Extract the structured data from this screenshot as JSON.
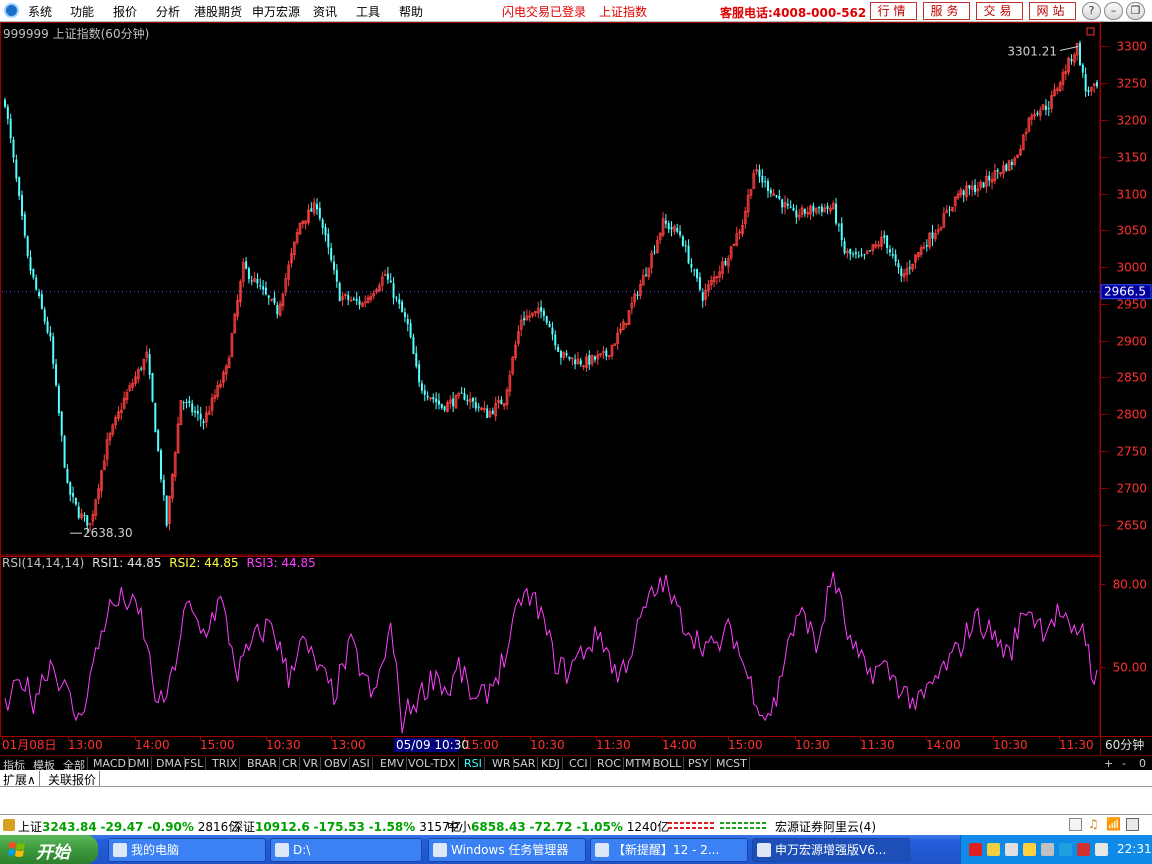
{
  "app": {
    "menu": [
      "系统",
      "功能",
      "报价",
      "分析",
      "港股期货",
      "申万宏源",
      "资讯",
      "工具",
      "帮助"
    ],
    "status_flash": "闪电交易已登录",
    "status_index": "上证指数",
    "hotline": "客服电话:4008-000-562",
    "quick_buttons": [
      "行情",
      "服务",
      "交易",
      "网站"
    ],
    "window_buttons": {
      "help": "?",
      "minimize": "–",
      "restore": "❐",
      "close": "✕"
    }
  },
  "chart_header": {
    "caption": "999999 上证指数(60分钟)",
    "rsi_name": "RSI(14,14,14)",
    "rsi1": "RSI1: 44.85",
    "rsi2": "RSI2: 44.85",
    "rsi3": "RSI3: 44.85",
    "period_label": "60分钟",
    "current_price": "2966.5"
  },
  "colors": {
    "up": "#ff4040",
    "down": "#54ffff",
    "rsi": "#ff40ff",
    "axis": "#a00000",
    "grid": "#8b0000",
    "price_tick": "#ff3030",
    "rsi2": "#ffff40"
  },
  "indicator_tabs": [
    "指标",
    "模板",
    "全部",
    "MACD",
    "DMI",
    "DMA",
    "FSL",
    "TRIX",
    "BRAR",
    "CR",
    "VR",
    "OBV",
    "ASI",
    "EMV",
    "VOL-TDX",
    "RSI",
    "WR",
    "SAR",
    "KDJ",
    "CCI",
    "ROC",
    "MTM",
    "BOLL",
    "PSY",
    "MCST"
  ],
  "indicator_controls": [
    "+",
    "-",
    "0"
  ],
  "extension_tabs": [
    "扩展∧",
    "关联报价"
  ],
  "index_bar": [
    {
      "name": "上证",
      "value": "3243.84",
      "change": "-29.47",
      "pct": "-0.90%",
      "amount": "2816亿"
    },
    {
      "name": "深证",
      "value": "10912.6",
      "change": "-175.53",
      "pct": "-1.58%",
      "amount": "3157亿"
    },
    {
      "name": "中小",
      "value": "6858.43",
      "change": "-72.72",
      "pct": "-1.05%",
      "amount": "1240亿"
    }
  ],
  "broker_label": "宏源证券阿里云(4)",
  "taskbar": {
    "start": "开始",
    "tasks": [
      "我的电脑",
      "D:\\",
      "Windows 任务管理器",
      "【新提醒】12 - 2...",
      "申万宏源增强版V6..."
    ],
    "clock": "22:31"
  },
  "chart_data": [
    {
      "type": "candlestick",
      "title": "999999 上证指数(60分钟)",
      "ylim": [
        2610,
        3325
      ],
      "yticks": [
        2650,
        2700,
        2750,
        2800,
        2850,
        2900,
        2950,
        3000,
        3050,
        3100,
        3150,
        3200,
        3250,
        3300
      ],
      "x_time_labels": [
        "01月08日",
        "13:00",
        "14:00",
        "15:00",
        "10:30",
        "13:00",
        "05/09 10:30",
        "15:00",
        "10:30",
        "11:30",
        "14:00",
        "15:00",
        "10:30",
        "11:30",
        "14:00",
        "10:30",
        "11:30"
      ],
      "highlighted_x_label": "05/09 10:30",
      "annotations": {
        "low": "2638.30",
        "high": "3301.21"
      },
      "current_price": 2966.5,
      "anchors": [
        [
          0,
          3225
        ],
        [
          8,
          3010
        ],
        [
          16,
          2900
        ],
        [
          22,
          2700
        ],
        [
          26,
          2665
        ],
        [
          30,
          2650
        ],
        [
          36,
          2760
        ],
        [
          42,
          2820
        ],
        [
          50,
          2880
        ],
        [
          57,
          2650
        ],
        [
          62,
          2820
        ],
        [
          70,
          2790
        ],
        [
          78,
          2860
        ],
        [
          84,
          3000
        ],
        [
          92,
          2960
        ],
        [
          96,
          2940
        ],
        [
          104,
          3060
        ],
        [
          110,
          3085
        ],
        [
          118,
          2960
        ],
        [
          126,
          2950
        ],
        [
          134,
          2990
        ],
        [
          142,
          2920
        ],
        [
          146,
          2840
        ],
        [
          154,
          2810
        ],
        [
          162,
          2825
        ],
        [
          170,
          2800
        ],
        [
          176,
          2820
        ],
        [
          182,
          2930
        ],
        [
          190,
          2940
        ],
        [
          196,
          2880
        ],
        [
          204,
          2870
        ],
        [
          212,
          2880
        ],
        [
          218,
          2920
        ],
        [
          226,
          2995
        ],
        [
          232,
          3060
        ],
        [
          238,
          3045
        ],
        [
          242,
          3000
        ],
        [
          246,
          2960
        ],
        [
          254,
          3010
        ],
        [
          260,
          3060
        ],
        [
          264,
          3130
        ],
        [
          270,
          3105
        ],
        [
          278,
          3070
        ],
        [
          286,
          3080
        ],
        [
          292,
          3080
        ],
        [
          296,
          3020
        ],
        [
          302,
          3010
        ],
        [
          310,
          3040
        ],
        [
          316,
          2985
        ],
        [
          322,
          3020
        ],
        [
          330,
          3060
        ],
        [
          336,
          3100
        ],
        [
          344,
          3110
        ],
        [
          350,
          3130
        ],
        [
          356,
          3145
        ],
        [
          362,
          3210
        ],
        [
          368,
          3220
        ],
        [
          374,
          3270
        ],
        [
          378,
          3300
        ],
        [
          381,
          3240
        ],
        [
          385,
          3243
        ]
      ],
      "candle_count": 386
    },
    {
      "type": "line",
      "series": [
        {
          "name": "RSI1",
          "last": 44.85
        }
      ],
      "ylim": [
        25,
        90
      ],
      "yticks": [
        50.0,
        80.0
      ],
      "anchors": [
        [
          0,
          34
        ],
        [
          6,
          46
        ],
        [
          10,
          38
        ],
        [
          16,
          52
        ],
        [
          22,
          40
        ],
        [
          26,
          30
        ],
        [
          30,
          46
        ],
        [
          36,
          70
        ],
        [
          42,
          75
        ],
        [
          48,
          68
        ],
        [
          54,
          35
        ],
        [
          58,
          42
        ],
        [
          64,
          72
        ],
        [
          70,
          62
        ],
        [
          76,
          74
        ],
        [
          82,
          48
        ],
        [
          88,
          60
        ],
        [
          94,
          66
        ],
        [
          100,
          46
        ],
        [
          104,
          60
        ],
        [
          110,
          50
        ],
        [
          116,
          40
        ],
        [
          122,
          58
        ],
        [
          130,
          38
        ],
        [
          136,
          64
        ],
        [
          140,
          30
        ],
        [
          142,
          34
        ],
        [
          148,
          42
        ],
        [
          152,
          48
        ],
        [
          156,
          40
        ],
        [
          160,
          50
        ],
        [
          166,
          36
        ],
        [
          172,
          44
        ],
        [
          178,
          58
        ],
        [
          182,
          76
        ],
        [
          188,
          72
        ],
        [
          194,
          52
        ],
        [
          198,
          48
        ],
        [
          204,
          56
        ],
        [
          210,
          62
        ],
        [
          216,
          46
        ],
        [
          220,
          54
        ],
        [
          226,
          72
        ],
        [
          232,
          81
        ],
        [
          238,
          68
        ],
        [
          244,
          60
        ],
        [
          250,
          56
        ],
        [
          256,
          64
        ],
        [
          262,
          46
        ],
        [
          268,
          32
        ],
        [
          272,
          38
        ],
        [
          276,
          60
        ],
        [
          282,
          70
        ],
        [
          286,
          56
        ],
        [
          292,
          84
        ],
        [
          298,
          58
        ],
        [
          304,
          48
        ],
        [
          310,
          50
        ],
        [
          316,
          42
        ],
        [
          322,
          36
        ],
        [
          330,
          48
        ],
        [
          336,
          56
        ],
        [
          342,
          68
        ],
        [
          348,
          62
        ],
        [
          354,
          54
        ],
        [
          360,
          72
        ],
        [
          366,
          64
        ],
        [
          372,
          70
        ],
        [
          376,
          60
        ],
        [
          380,
          66
        ],
        [
          383,
          50
        ],
        [
          385,
          45
        ]
      ]
    }
  ]
}
